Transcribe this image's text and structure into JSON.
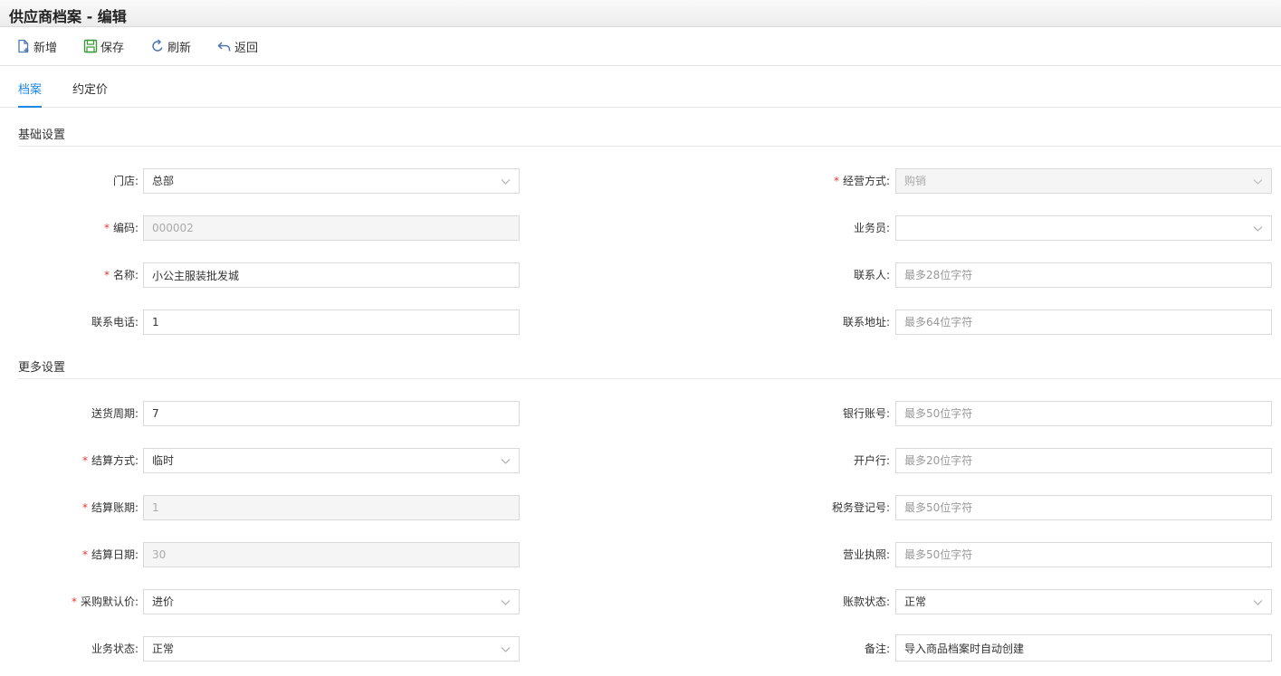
{
  "window": {
    "title": "供应商档案 - 编辑"
  },
  "toolbar": {
    "new_label": "新增",
    "save_label": "保存",
    "refresh_label": "刷新",
    "back_label": "返回"
  },
  "tabs": [
    {
      "label": "档案",
      "active": true
    },
    {
      "label": "约定价",
      "active": false
    }
  ],
  "sections": {
    "basic": "基础设置",
    "more": "更多设置"
  },
  "basic": {
    "store": {
      "label": "门店:",
      "value": "总部",
      "required": false
    },
    "code": {
      "label": "编码:",
      "value": "000002",
      "required": true
    },
    "name": {
      "label": "名称:",
      "value": "小公主服装批发城",
      "required": true
    },
    "phone": {
      "label": "联系电话:",
      "value": "1",
      "required": false
    },
    "mode": {
      "label": "经营方式:",
      "value": "购销",
      "required": true
    },
    "salesman": {
      "label": "业务员:",
      "value": "",
      "required": false
    },
    "contact": {
      "label": "联系人:",
      "placeholder": "最多28位字符",
      "required": false
    },
    "address": {
      "label": "联系地址:",
      "placeholder": "最多64位字符",
      "required": false
    }
  },
  "more": {
    "delivery": {
      "label": "送货周期:",
      "value": "7",
      "required": false
    },
    "settle_mode": {
      "label": "结算方式:",
      "value": "临时",
      "required": true
    },
    "settle_period": {
      "label": "结算账期:",
      "value": "1",
      "required": true
    },
    "settle_date": {
      "label": "结算日期:",
      "value": "30",
      "required": true
    },
    "purchase_price": {
      "label": "采购默认价:",
      "value": "进价",
      "required": true
    },
    "biz_status": {
      "label": "业务状态:",
      "value": "正常",
      "required": false
    },
    "bank_account": {
      "label": "银行账号:",
      "placeholder": "最多50位字符",
      "required": false
    },
    "bank": {
      "label": "开户行:",
      "placeholder": "最多20位字符",
      "required": false
    },
    "tax_no": {
      "label": "税务登记号:",
      "placeholder": "最多50位字符",
      "required": false
    },
    "license": {
      "label": "营业执照:",
      "placeholder": "最多50位字符",
      "required": false
    },
    "payment_status": {
      "label": "账款状态:",
      "value": "正常",
      "required": false
    },
    "remark": {
      "label": "备注:",
      "value": "导入商品档案时自动创建",
      "required": false
    }
  },
  "colors": {
    "accent": "#1e88e5",
    "required": "#e53935"
  }
}
